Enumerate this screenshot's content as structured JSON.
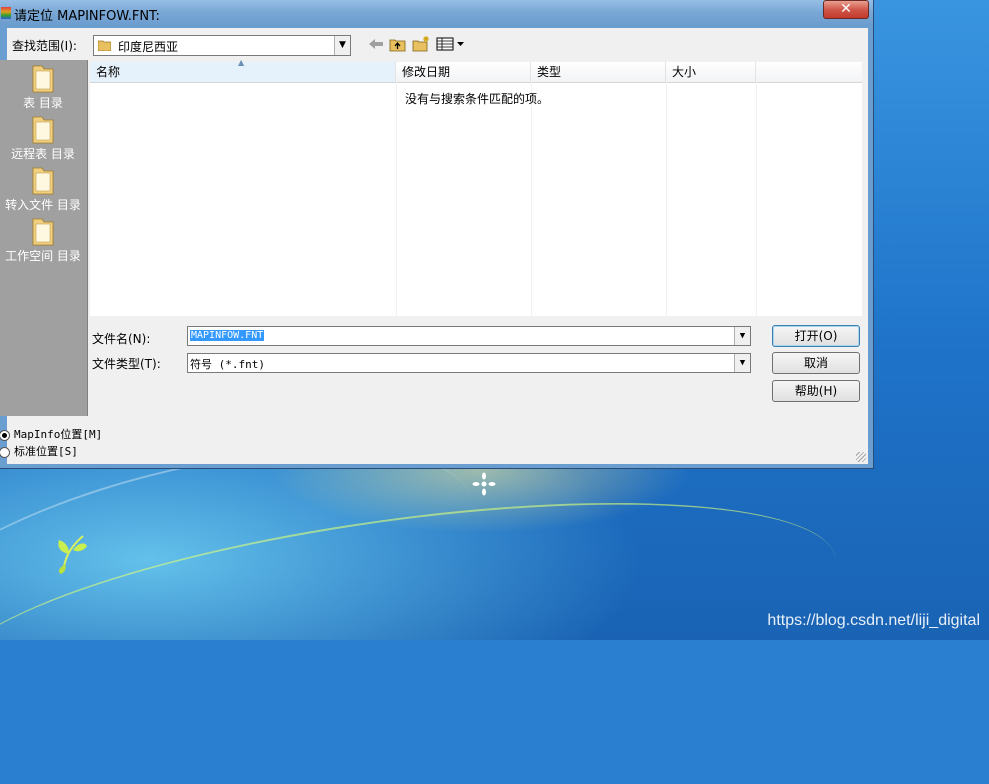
{
  "dialog": {
    "title": "请定位 MAPINFOW.FNT:",
    "close_glyph": "✕"
  },
  "lookin": {
    "label": "查找范围(I):",
    "value": "印度尼西亚",
    "folder_icon": "folder-icon"
  },
  "toolbar": {
    "back_icon": "back-arrow-icon",
    "up_icon": "up-folder-icon",
    "newfolder_icon": "new-folder-icon",
    "view_icon": "view-menu-icon"
  },
  "places": [
    {
      "label": "表 目录"
    },
    {
      "label": "远程表 目录"
    },
    {
      "label": "转入文件 目录"
    },
    {
      "label": "工作空间 目录"
    }
  ],
  "filelist": {
    "columns": [
      "名称",
      "修改日期",
      "类型",
      "大小"
    ],
    "empty_message": "没有与搜索条件匹配的项。"
  },
  "filename": {
    "label": "文件名(N):",
    "value": "MAPINFOW.FNT"
  },
  "filetype": {
    "label": "文件类型(T):",
    "value": "符号 (*.fnt)"
  },
  "buttons": {
    "open": "打开(O)",
    "cancel": "取消",
    "help": "帮助(H)"
  },
  "radios": [
    {
      "label": "MapInfo位置[M]",
      "checked": true
    },
    {
      "label": "标准位置[S]",
      "checked": false
    }
  ],
  "watermark": "https://blog.csdn.net/liji_digital",
  "colors": {
    "selection": "#3399ff",
    "titlebar": "#7aa8d6",
    "close_button": "#c23a2c",
    "places_bar": "#a0a0a0"
  }
}
